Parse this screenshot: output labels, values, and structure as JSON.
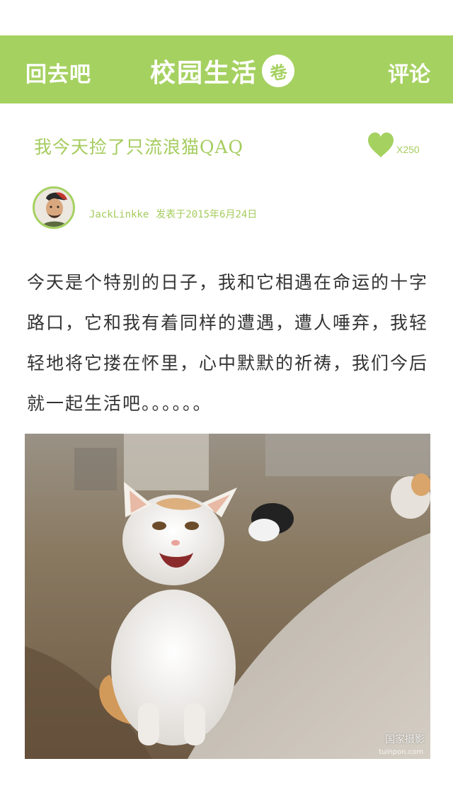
{
  "nav": {
    "back_label": "回去吧",
    "title": "校园生活",
    "badge": "卷",
    "comment_label": "评论"
  },
  "post": {
    "title": "我今天捡了只流浪猫QAQ",
    "like_count": "X250",
    "author": "JackLinkke",
    "published": "发表于2015年6月24日",
    "body": "今天是个特别的日子，我和它相遇在命运的十字路口，它和我有着同样的遭遇，遭人唾弃，我轻轻地将它搂在怀里，心中默默的祈祷，我们今后就一起生活吧。。。。。。",
    "watermark": "国家摄影",
    "watermark_sub": "tuinpon.com"
  },
  "colors": {
    "accent": "#a5d160",
    "text": "#333333"
  },
  "icons": {
    "like": "heart-icon",
    "badge": "juan-badge-icon"
  }
}
